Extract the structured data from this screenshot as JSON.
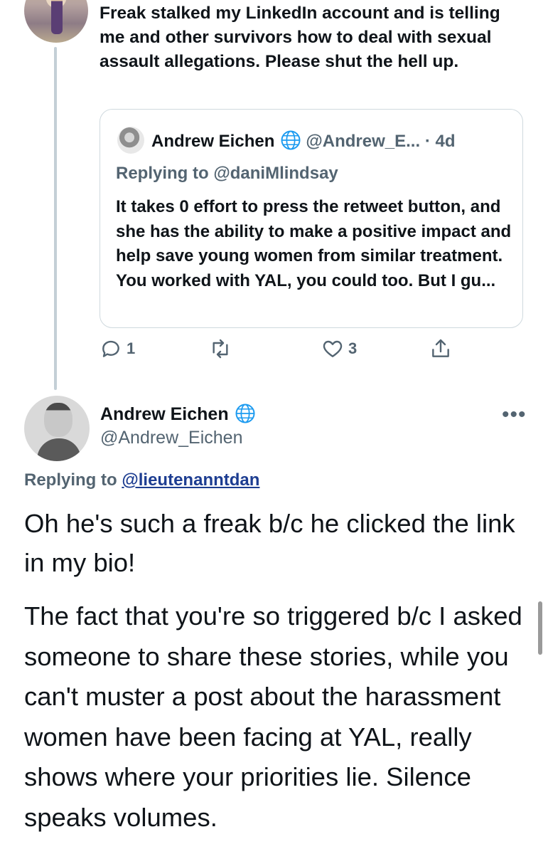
{
  "parent_tweet": {
    "text": "Freak stalked my LinkedIn account and is telling me and other survivors how to deal with sexual assault allegations. Please shut the hell up."
  },
  "quoted_tweet": {
    "name": "Andrew Eichen",
    "handle": "@Andrew_E...",
    "time": "· 4d",
    "replying_to": "Replying to @daniMlindsay",
    "text": "It takes 0 effort to press the retweet button, and she has the ability to make a positive impact and help save young women from similar treatment. You worked with YAL, you could too. But I gu..."
  },
  "actions": {
    "reply_count": "1",
    "retweet_count": "",
    "like_count": "3",
    "icons": [
      "reply-icon",
      "retweet-icon",
      "like-icon",
      "share-icon"
    ]
  },
  "main_tweet": {
    "name": "Andrew Eichen",
    "handle": "@Andrew_Eichen",
    "more": "•••",
    "replying_prefix": "Replying to ",
    "replying_user": "@lieutenanntdan",
    "paragraph_1": "Oh he's such a freak b/c he clicked the link in my bio!",
    "paragraph_2": "The fact that you're so triggered b/c I asked someone to share these stories, while you can't muster a post about the harassment women have been facing at YAL, really shows where your priorities lie. Silence speaks volumes."
  },
  "colors": {
    "text": "#0f1419",
    "secondary": "#536471",
    "link": "#1d3d91",
    "border": "#cfd9de",
    "thread_line": "#c4cfd6"
  }
}
